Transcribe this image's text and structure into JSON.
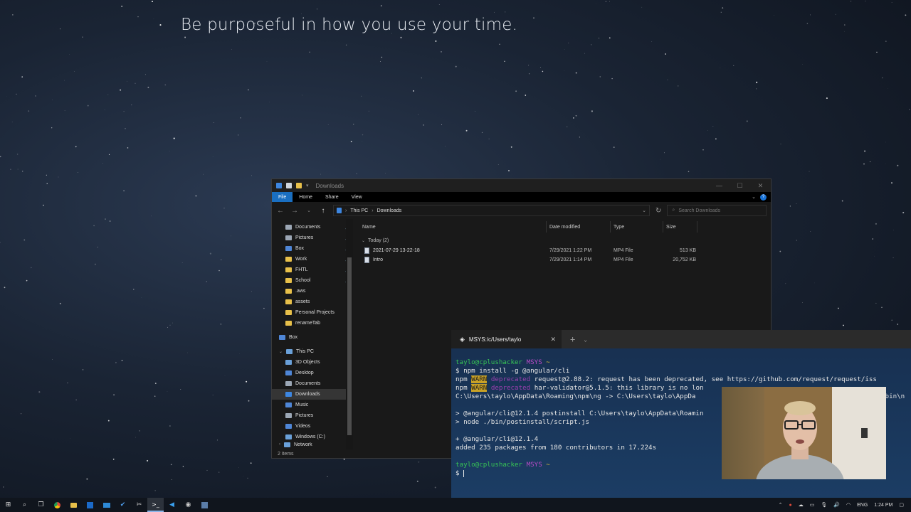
{
  "desktop": {
    "quote": "Be purposeful in how you use your time."
  },
  "explorer": {
    "title": "Downloads",
    "ribbon_tabs": [
      "File",
      "Home",
      "Share",
      "View"
    ],
    "breadcrumb": [
      "This PC",
      "Downloads"
    ],
    "search_placeholder": "Search Downloads",
    "nav_items": [
      {
        "label": "Documents",
        "icon": "documents-icon",
        "pinned": true
      },
      {
        "label": "Pictures",
        "icon": "pictures-icon",
        "pinned": true
      },
      {
        "label": "Box",
        "icon": "box-folder-icon",
        "pinned": true
      },
      {
        "label": "Work",
        "icon": "folder-icon",
        "pinned": true
      },
      {
        "label": "FHTL",
        "icon": "folder-icon",
        "pinned": true
      },
      {
        "label": "School",
        "icon": "folder-icon",
        "pinned": true
      },
      {
        "label": ".aws",
        "icon": "folder-icon",
        "pinned": false
      },
      {
        "label": "assets",
        "icon": "folder-icon",
        "pinned": false
      },
      {
        "label": "Personal Projects",
        "icon": "folder-icon",
        "pinned": false
      },
      {
        "label": "renameTab",
        "icon": "folder-icon",
        "pinned": false
      }
    ],
    "nav_box": "Box",
    "nav_thispc": "This PC",
    "nav_pc_items": [
      {
        "label": "3D Objects",
        "icon": "3d-objects-icon"
      },
      {
        "label": "Desktop",
        "icon": "desktop-icon"
      },
      {
        "label": "Documents",
        "icon": "documents-icon"
      },
      {
        "label": "Downloads",
        "icon": "downloads-icon",
        "selected": true
      },
      {
        "label": "Music",
        "icon": "music-icon"
      },
      {
        "label": "Pictures",
        "icon": "pictures-icon"
      },
      {
        "label": "Videos",
        "icon": "videos-icon"
      },
      {
        "label": "Windows (C:)",
        "icon": "drive-icon"
      }
    ],
    "nav_network": "Network",
    "columns": {
      "name": "Name",
      "date": "Date modified",
      "type": "Type",
      "size": "Size"
    },
    "group_label": "Today (2)",
    "files": [
      {
        "name": "2021-07-29 13-22-18",
        "date": "7/29/2021 1:22 PM",
        "type": "MP4 File",
        "size": "513 KB"
      },
      {
        "name": "Intro",
        "date": "7/29/2021 1:14 PM",
        "type": "MP4 File",
        "size": "20,752 KB"
      }
    ],
    "status": "2 items"
  },
  "terminal": {
    "tab_title": "MSYS:/c/Users/taylo",
    "prompt_user": "taylo@cplushacker",
    "prompt_env": "MSYS",
    "prompt_path": "~",
    "command": "$ npm install -g @angular/cli",
    "npm": "npm",
    "warn": "WARN",
    "deprecated": "deprecated",
    "warn1": "request@2.88.2: request has been deprecated, see https://github.com/request/request/iss",
    "warn2": "har-validator@5.1.5: this library is no lon",
    "link_line": "C:\\Users\\taylo\\AppData\\Roaming\\npm\\ng -> C:\\Users\\taylo\\AppDa",
    "link_tail": "\\bin\\n",
    "postinstall": "> @angular/cli@12.1.4 postinstall C:\\Users\\taylo\\AppData\\Roamin",
    "node_line": "> node ./bin/postinstall/script.js",
    "added_pkg": "+ @angular/cli@12.1.4",
    "added_summary": "added 235 packages from 180 contributors in 17.224s",
    "final_prompt": "$ "
  },
  "taskbar": {
    "language": "ENG",
    "time": "1:24 PM"
  }
}
